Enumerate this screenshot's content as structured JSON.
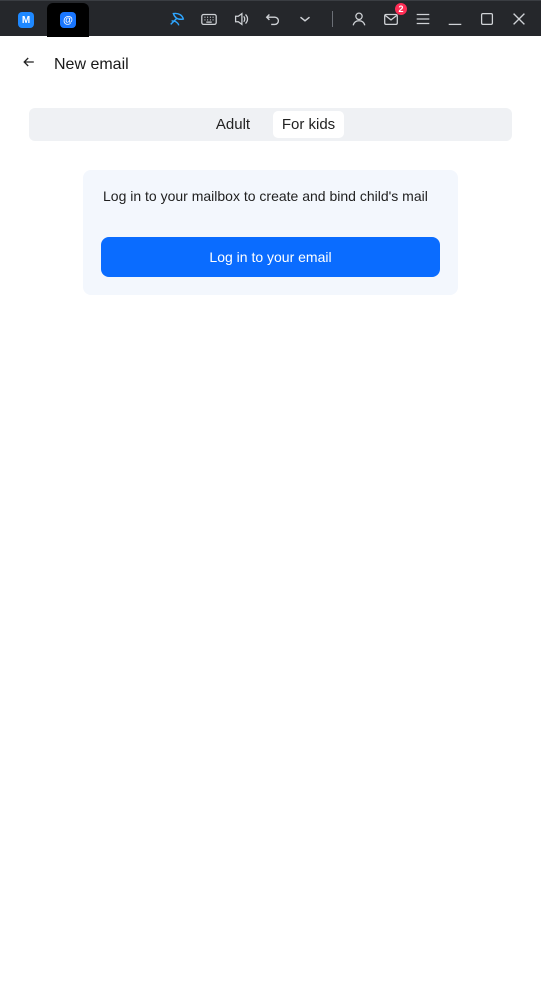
{
  "emulator_bar": {
    "tabs": [
      {
        "icon": "app-logo-icon",
        "glyph": "M"
      },
      {
        "icon": "email-app-icon",
        "glyph": "@"
      }
    ],
    "notification_count": "2",
    "icons": [
      "feather-icon",
      "keyboard-icon",
      "volume-icon",
      "undo-icon",
      "chevron-down-icon",
      "user-icon",
      "mail-icon",
      "menu-icon",
      "minimize-icon",
      "maximize-icon",
      "close-icon"
    ]
  },
  "header": {
    "back_icon": "arrow-left-icon",
    "title": "New email"
  },
  "segment": {
    "options": [
      "Adult",
      "For kids"
    ],
    "selected": "For kids"
  },
  "card": {
    "message": "Log in to your mailbox to create and bind child's mail",
    "button_label": "Log in to your email"
  },
  "colors": {
    "topbar": "#25272b",
    "accent": "#0a6cff",
    "card_bg": "#f3f7fd",
    "segment_bg": "#eff1f4"
  }
}
